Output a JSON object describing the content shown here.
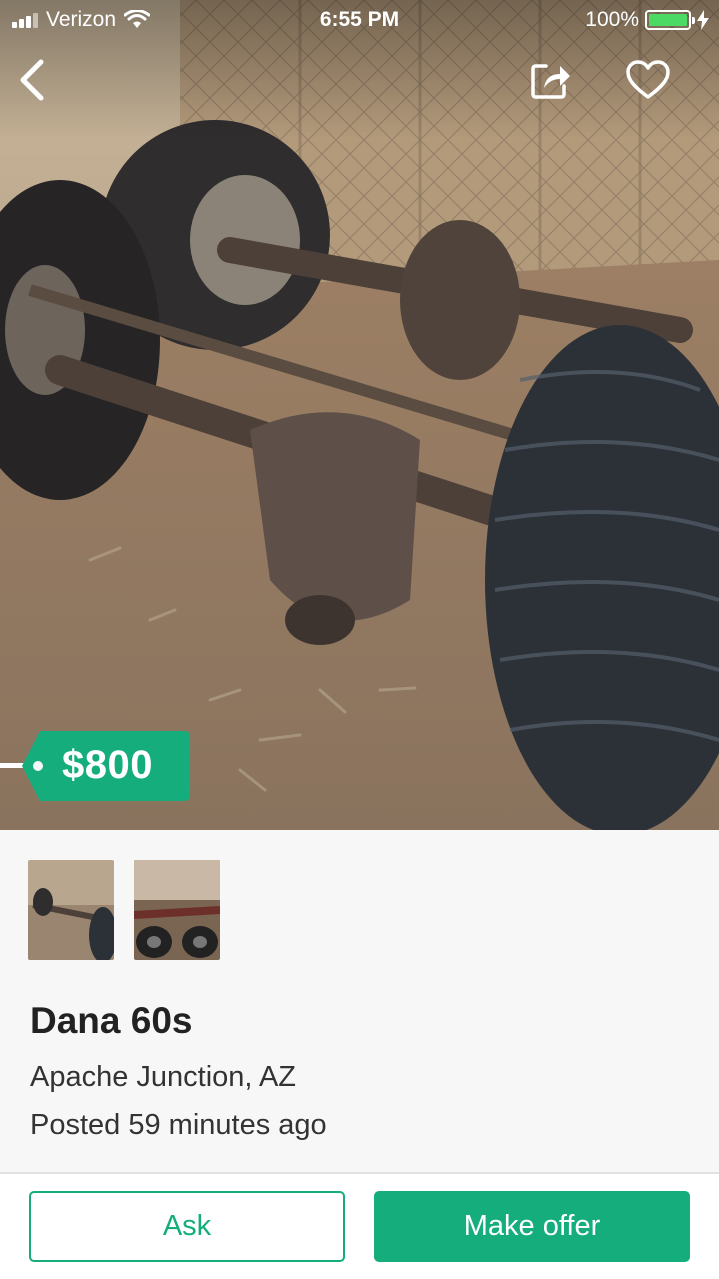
{
  "status_bar": {
    "carrier": "Verizon",
    "time": "6:55 PM",
    "battery": "100%"
  },
  "nav": {
    "back_icon": "chevron-left-icon",
    "share_icon": "share-icon",
    "favorite_icon": "heart-icon"
  },
  "listing": {
    "price": "$800",
    "title": "Dana 60s",
    "location": "Apache Junction, AZ",
    "posted": "Posted 59 minutes ago",
    "photo_count": 2
  },
  "actions": {
    "ask_label": "Ask",
    "offer_label": "Make offer"
  },
  "colors": {
    "accent": "#15ad7c",
    "battery": "#4cd964"
  }
}
